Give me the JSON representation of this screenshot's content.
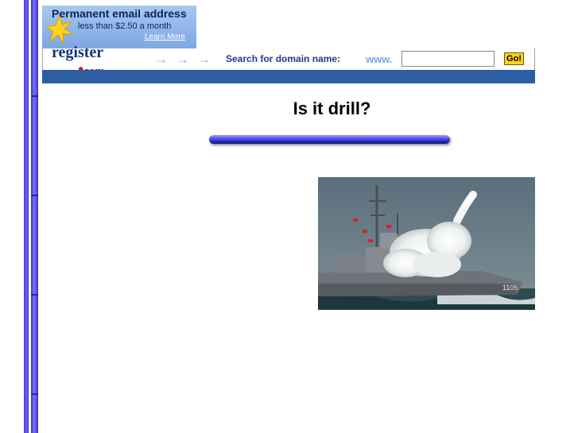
{
  "ad": {
    "promo_title": "Permanent email address",
    "promo_subtitle": "less than $2.50 a month",
    "promo_link": "Learn More",
    "logo_main": "register",
    "logo_com": "com",
    "search_label": "Search for domain name:",
    "www_prefix": "www.",
    "domain_input_value": "",
    "go_label": "Go!"
  },
  "page": {
    "title": "Is it drill?"
  },
  "photo": {
    "hull_number": "1105"
  },
  "colors": {
    "border_blue": "#5a52ee",
    "banner_band": "#2d5ea4",
    "go_button": "#ffd21c",
    "promo_bg": "#a6c8f2"
  }
}
